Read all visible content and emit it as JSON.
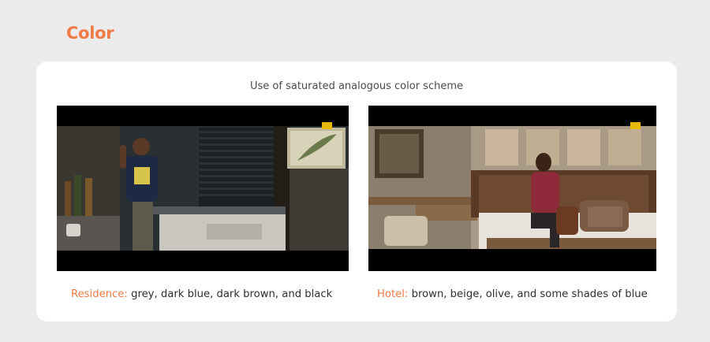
{
  "page": {
    "title": "Color"
  },
  "card": {
    "heading": "Use of saturated analogous color scheme"
  },
  "scenes": [
    {
      "label": "Residence:",
      "description": " grey, dark blue, dark brown, and black"
    },
    {
      "label": "Hotel:",
      "description": " brown, beige, olive, and some shades of blue"
    }
  ],
  "colors": {
    "accent": "#f07a45",
    "background": "#ebebec",
    "card": "#ffffff"
  }
}
